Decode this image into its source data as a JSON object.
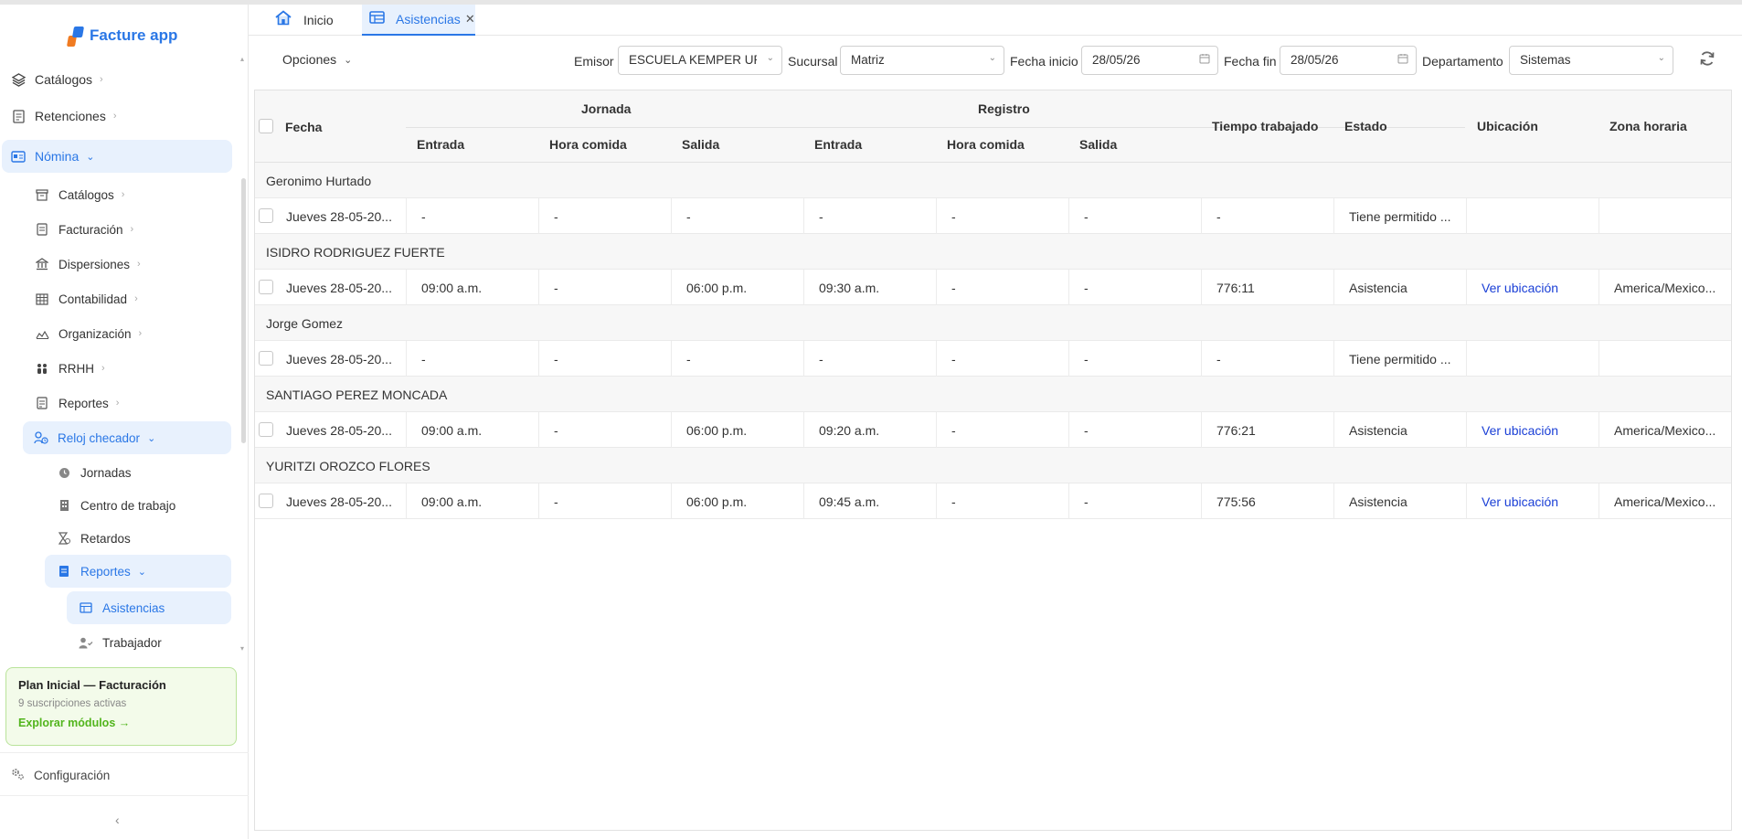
{
  "app": {
    "name": "Facture app"
  },
  "sidebar": {
    "items": [
      {
        "label": "Catálogos"
      },
      {
        "label": "Retenciones"
      },
      {
        "label": "Nómina"
      }
    ],
    "nomina_children": [
      {
        "label": "Catálogos"
      },
      {
        "label": "Facturación"
      },
      {
        "label": "Dispersiones"
      },
      {
        "label": "Contabilidad"
      },
      {
        "label": "Organización"
      },
      {
        "label": "RRHH"
      },
      {
        "label": "Reportes"
      },
      {
        "label": "Reloj checador"
      }
    ],
    "reloj_children": [
      {
        "label": "Jornadas"
      },
      {
        "label": "Centro de trabajo"
      },
      {
        "label": "Retardos"
      },
      {
        "label": "Reportes"
      }
    ],
    "reportes_children": [
      {
        "label": "Asistencias"
      },
      {
        "label": "Trabajador"
      }
    ],
    "plan": {
      "title": "Plan Inicial — Facturación",
      "subtitle": "9 suscripciones activas",
      "link": "Explorar módulos →"
    },
    "config_label": "Configuración"
  },
  "tabs": [
    {
      "label": "Inicio"
    },
    {
      "label": "Asistencias"
    }
  ],
  "filters": {
    "opciones_label": "Opciones",
    "emisor_label": "Emisor",
    "emisor_value": "ESCUELA KEMPER URG",
    "sucursal_label": "Sucursal",
    "sucursal_value": "Matriz",
    "fecha_inicio_label": "Fecha inicio",
    "fecha_inicio_value": "28/05/26",
    "fecha_fin_label": "Fecha fin",
    "fecha_fin_value": "28/05/26",
    "departamento_label": "Departamento",
    "departamento_value": "Sistemas"
  },
  "table": {
    "headers": {
      "fecha": "Fecha",
      "jornada": "Jornada",
      "registro": "Registro",
      "entrada": "Entrada",
      "hora_comida": "Hora comida",
      "salida": "Salida",
      "tiempo": "Tiempo trabajado",
      "estado": "Estado",
      "ubicacion": "Ubicación",
      "zona": "Zona horaria"
    },
    "groups": [
      {
        "name": "Geronimo Hurtado",
        "row": {
          "fecha": "Jueves 28-05-20...",
          "j_entrada": "-",
          "j_comida": "-",
          "j_salida": "-",
          "r_entrada": "-",
          "r_comida": "-",
          "r_salida": "-",
          "tiempo": "-",
          "estado": "Tiene permitido ...",
          "ubicacion": "",
          "zona": ""
        }
      },
      {
        "name": "ISIDRO RODRIGUEZ FUERTE",
        "row": {
          "fecha": "Jueves 28-05-20...",
          "j_entrada": "09:00 a.m.",
          "j_comida": "-",
          "j_salida": "06:00 p.m.",
          "r_entrada": "09:30 a.m.",
          "r_comida": "-",
          "r_salida": "-",
          "tiempo": "776:11",
          "estado": "Asistencia",
          "ubicacion": "Ver ubicación",
          "zona": "America/Mexico..."
        }
      },
      {
        "name": "Jorge Gomez",
        "row": {
          "fecha": "Jueves 28-05-20...",
          "j_entrada": "-",
          "j_comida": "-",
          "j_salida": "-",
          "r_entrada": "-",
          "r_comida": "-",
          "r_salida": "-",
          "tiempo": "-",
          "estado": "Tiene permitido ...",
          "ubicacion": "",
          "zona": ""
        }
      },
      {
        "name": "SANTIAGO PEREZ MONCADA",
        "row": {
          "fecha": "Jueves 28-05-20...",
          "j_entrada": "09:00 a.m.",
          "j_comida": "-",
          "j_salida": "06:00 p.m.",
          "r_entrada": "09:20 a.m.",
          "r_comida": "-",
          "r_salida": "-",
          "tiempo": "776:21",
          "estado": "Asistencia",
          "ubicacion": "Ver ubicación",
          "zona": "America/Mexico..."
        }
      },
      {
        "name": "YURITZI OROZCO FLORES",
        "row": {
          "fecha": "Jueves 28-05-20...",
          "j_entrada": "09:00 a.m.",
          "j_comida": "-",
          "j_salida": "06:00 p.m.",
          "r_entrada": "09:45 a.m.",
          "r_comida": "-",
          "r_salida": "-",
          "tiempo": "775:56",
          "estado": "Asistencia",
          "ubicacion": "Ver ubicación",
          "zona": "America/Mexico..."
        }
      }
    ]
  },
  "colors": {
    "accent": "#2a77e6",
    "link": "#1a3fd6",
    "plan_green": "#52b51d"
  }
}
